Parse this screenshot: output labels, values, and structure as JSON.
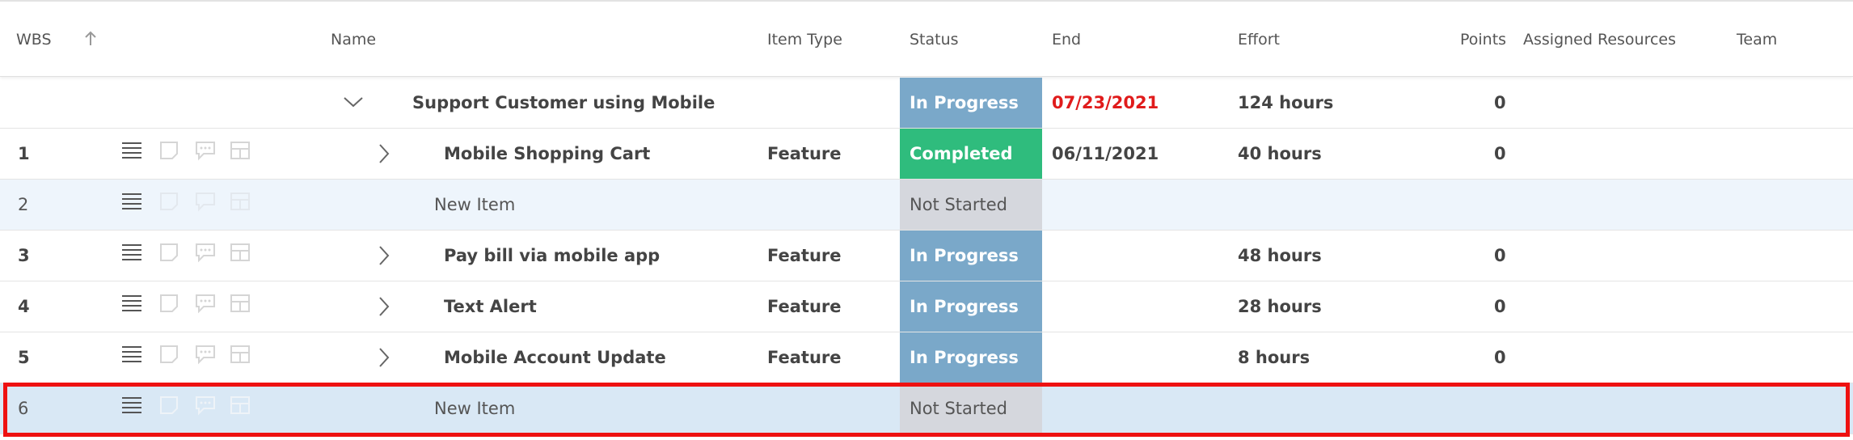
{
  "columns": {
    "wbs": "WBS",
    "name": "Name",
    "item_type": "Item Type",
    "status": "Status",
    "end": "End",
    "effort": "Effort",
    "points": "Points",
    "assigned_resources": "Assigned Resources",
    "team": "Team"
  },
  "header_icons": {
    "sort": "arrow-up-icon"
  },
  "colors": {
    "in_progress": "#7aa8c9",
    "completed": "#2fbc7d",
    "not_started": "#d5d7dd",
    "overdue_date": "#e01b1b",
    "selection_outline": "#ee1111"
  },
  "rows": [
    {
      "wbs": "",
      "name": "Support Customer using Mobile",
      "item_type": "",
      "status": "In Progress",
      "end": "07/23/2021",
      "effort": "124 hours",
      "points": "0"
    },
    {
      "wbs": "1",
      "name": "Mobile Shopping Cart",
      "item_type": "Feature",
      "status": "Completed",
      "end": "06/11/2021",
      "effort": "40 hours",
      "points": "0"
    },
    {
      "wbs": "2",
      "name": "New Item",
      "item_type": "",
      "status": "Not Started",
      "end": "",
      "effort": "",
      "points": ""
    },
    {
      "wbs": "3",
      "name": "Pay bill via mobile app",
      "item_type": "Feature",
      "status": "In Progress",
      "end": "",
      "effort": "48 hours",
      "points": "0"
    },
    {
      "wbs": "4",
      "name": "Text Alert",
      "item_type": "Feature",
      "status": "In Progress",
      "end": "",
      "effort": "28 hours",
      "points": "0"
    },
    {
      "wbs": "5",
      "name": "Mobile Account Update",
      "item_type": "Feature",
      "status": "In Progress",
      "end": "",
      "effort": "8 hours",
      "points": "0"
    },
    {
      "wbs": "6",
      "name": "New Item",
      "item_type": "",
      "status": "Not Started",
      "end": "",
      "effort": "",
      "points": ""
    }
  ]
}
